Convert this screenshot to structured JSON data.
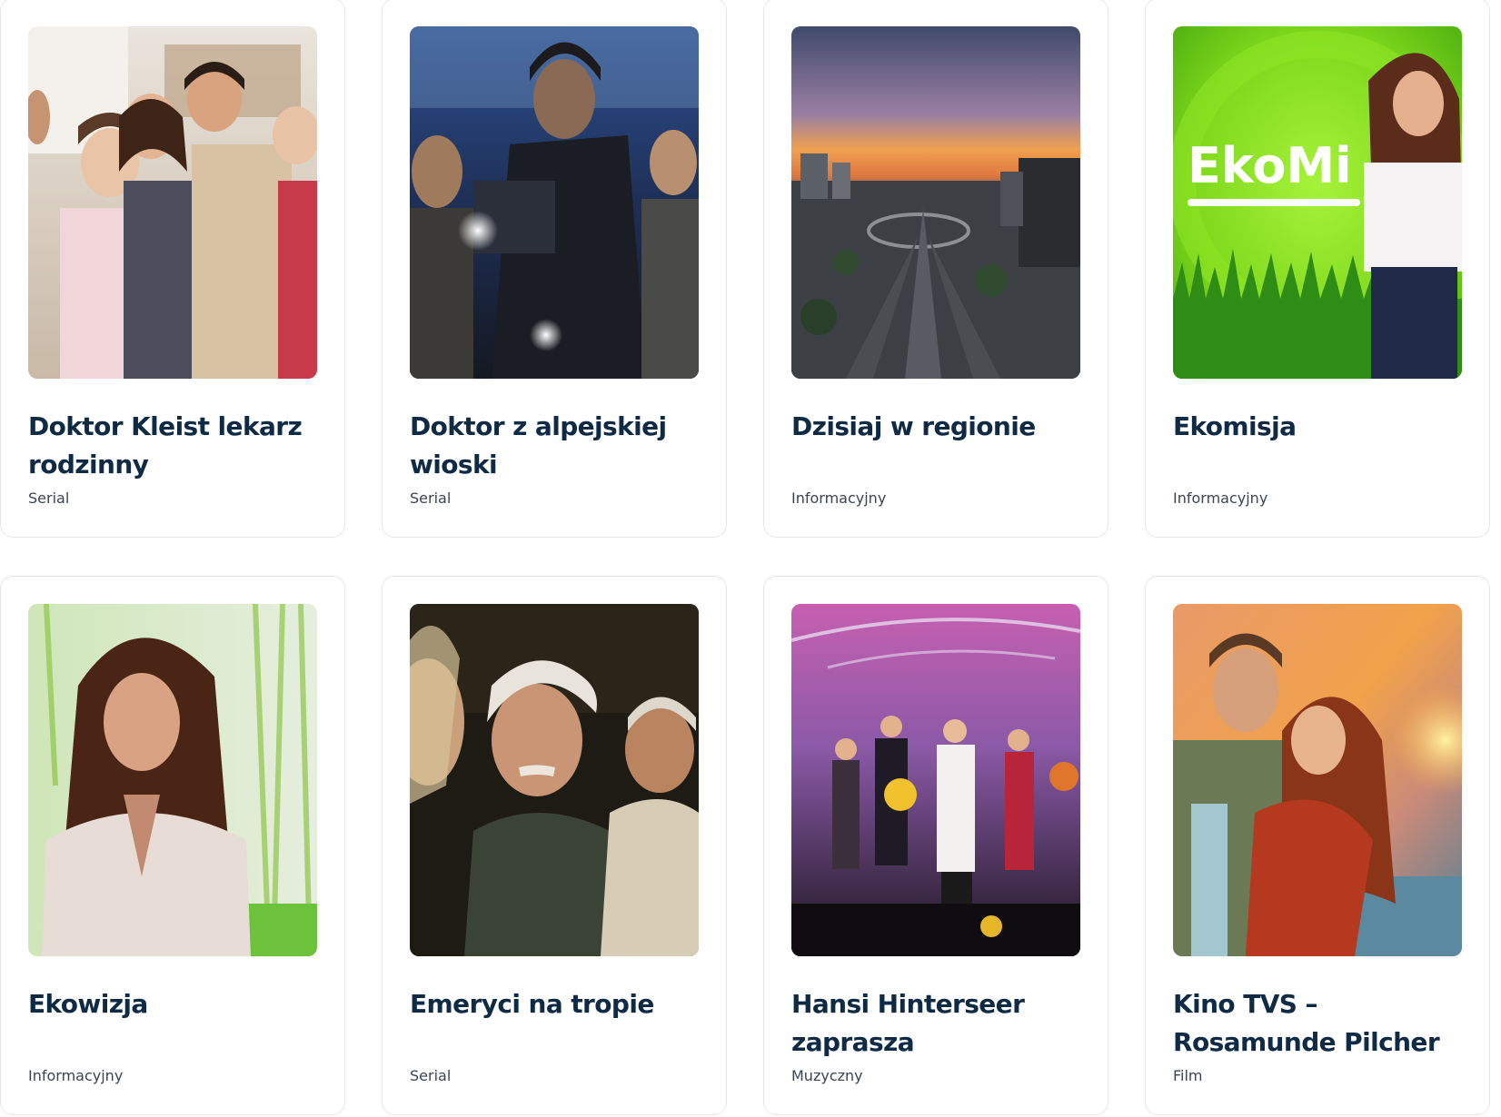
{
  "shows": [
    {
      "title": "Doktor Kleist lekarz rodzinny",
      "genre": "Serial",
      "image": "family-portrait-image"
    },
    {
      "title": "Doktor z alpejskiej wioski",
      "genre": "Serial",
      "image": "night-lantern-scene-image"
    },
    {
      "title": "Dzisiaj w regionie",
      "genre": "Informacyjny",
      "image": "city-sunset-aerial-image"
    },
    {
      "title": "Ekomisja",
      "genre": "Informacyjny",
      "image": "presenter-green-studio-image",
      "image_text": "EkoMi"
    },
    {
      "title": "Ekowizja",
      "genre": "Informacyjny",
      "image": "presenter-portrait-image"
    },
    {
      "title": "Emeryci na tropie",
      "genre": "Serial",
      "image": "elderly-men-scene-image"
    },
    {
      "title": "Hansi Hinterseer zaprasza",
      "genre": "Muzyczny",
      "image": "concert-stage-image"
    },
    {
      "title": "Kino TVS – Rosamunde Pilcher",
      "genre": "Film",
      "image": "couple-sunset-coast-image"
    }
  ],
  "colors": {
    "title": "#0f2a45",
    "genre": "#3a4452",
    "card_border": "#e4e7eb"
  }
}
